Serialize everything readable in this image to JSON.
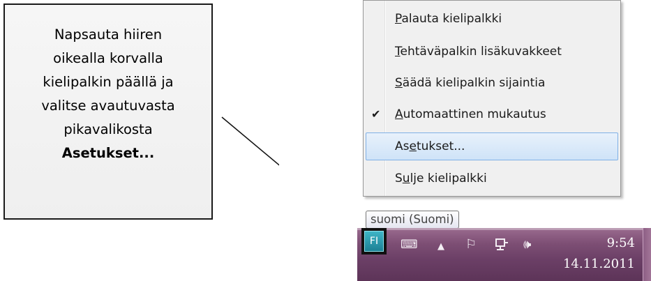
{
  "callout": {
    "lines": [
      "Napsauta hiiren",
      "oikealla korvalla",
      "kielipalkin päällä ja",
      "valitse avautuvasta",
      "pikavalikosta"
    ],
    "emphasis": "Asetukset..."
  },
  "context_menu": {
    "items": [
      {
        "label": "Palauta kielipalkki",
        "underline": "P",
        "checked": false,
        "highlighted": false
      },
      {
        "label": "Tehtäväpalkin lisäkuvakkeet",
        "underline": "T",
        "checked": false,
        "highlighted": false
      },
      {
        "label": "Säädä kielipalkin sijaintia",
        "underline": "S",
        "checked": false,
        "highlighted": false
      },
      {
        "label": "Automaattinen mukautus",
        "underline": "A",
        "checked": true,
        "highlighted": false
      },
      {
        "label": "Asetukset...",
        "underline": "e",
        "checked": false,
        "highlighted": true
      },
      {
        "label": "Sulje kielipalkki",
        "underline": "u",
        "checked": false,
        "highlighted": false
      }
    ],
    "check_glyph": "✔"
  },
  "tooltip": {
    "text": "suomi (Suomi)"
  },
  "taskbar": {
    "language_button": "FI",
    "tray_icons": [
      "keyboard-icon",
      "show-hidden-icons-arrow",
      "action-center-flag-icon",
      "network-icon",
      "volume-icon"
    ],
    "clock_time": "9:54",
    "clock_date": "14.11.2011",
    "accent_color": "#7d4e74",
    "highlight_color": "#cfe3f8"
  }
}
